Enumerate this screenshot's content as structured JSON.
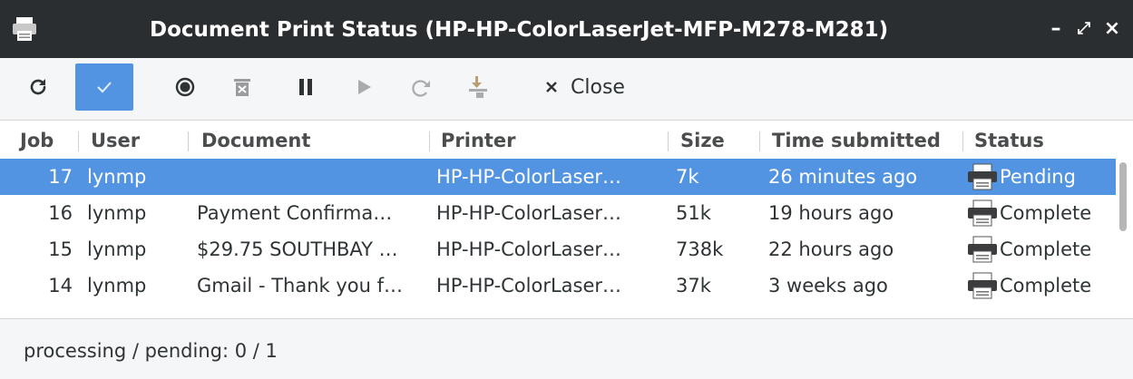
{
  "window": {
    "title": "Document Print Status (HP-HP-ColorLaserJet-MFP-M278-M281)",
    "buttons": {
      "minimize": "–",
      "maximize": "⤢",
      "close": "×"
    }
  },
  "toolbar": {
    "refresh_icon": "refresh-icon",
    "show_completed_icon": "checkmark-icon",
    "close_label": "Close"
  },
  "table": {
    "headers": [
      "Job",
      "User",
      "Document",
      "Printer",
      "Size",
      "Time submitted",
      "Status"
    ],
    "rows": [
      {
        "job": "17",
        "user": "lynmp",
        "document": "",
        "printer": "HP-HP-ColorLaser…",
        "size": "7k",
        "time": "26 minutes ago",
        "status": "Pending",
        "selected": true
      },
      {
        "job": "16",
        "user": "lynmp",
        "document": "Payment Confirma…",
        "printer": "HP-HP-ColorLaser…",
        "size": "51k",
        "time": "19 hours ago",
        "status": "Complete",
        "selected": false
      },
      {
        "job": "15",
        "user": "lynmp",
        "document": "$29.75 SOUTHBAY …",
        "printer": "HP-HP-ColorLaser…",
        "size": "738k",
        "time": "22 hours ago",
        "status": "Complete",
        "selected": false
      },
      {
        "job": "14",
        "user": "lynmp",
        "document": "Gmail - Thank you f…",
        "printer": "HP-HP-ColorLaser…",
        "size": "37k",
        "time": "3 weeks ago",
        "status": "Complete",
        "selected": false
      }
    ]
  },
  "statusbar": {
    "text": "processing / pending:  0 / 1"
  },
  "colors": {
    "titlebar": "#2b2e30",
    "accent": "#5294e2",
    "background": "#f5f6f7"
  }
}
